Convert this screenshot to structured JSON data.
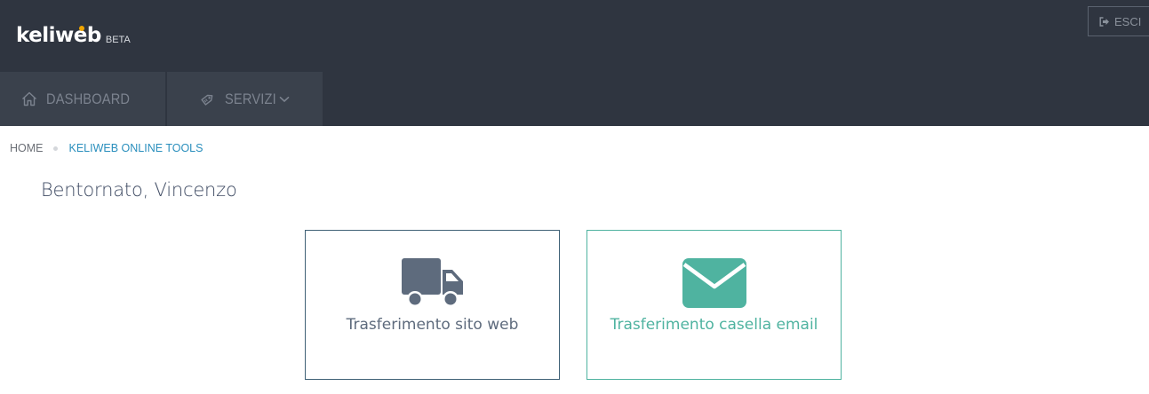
{
  "header": {
    "logo_text": "keliweb",
    "logo_badge": "BETA",
    "logout_label": "ESCI"
  },
  "nav": {
    "items": [
      {
        "label": "DASHBOARD",
        "icon": "home-icon"
      },
      {
        "label": "SERVIZI",
        "icon": "tag-icon",
        "has_dropdown": true
      }
    ]
  },
  "breadcrumb": {
    "home": "HOME",
    "current": "KELIWEB ONLINE TOOLS"
  },
  "welcome": "Bentornato, Vincenzo",
  "cards": [
    {
      "label": "Trasferimento sito web",
      "icon": "truck-icon",
      "color": "#5e6b7d"
    },
    {
      "label": "Trasferimento casella email",
      "icon": "envelope-icon",
      "color": "#4fb3a0"
    }
  ],
  "colors": {
    "header_bg": "#2f3540",
    "nav_bg": "#3a414c",
    "accent_blue": "#2a8fbd",
    "accent_teal": "#4fb3a0"
  }
}
